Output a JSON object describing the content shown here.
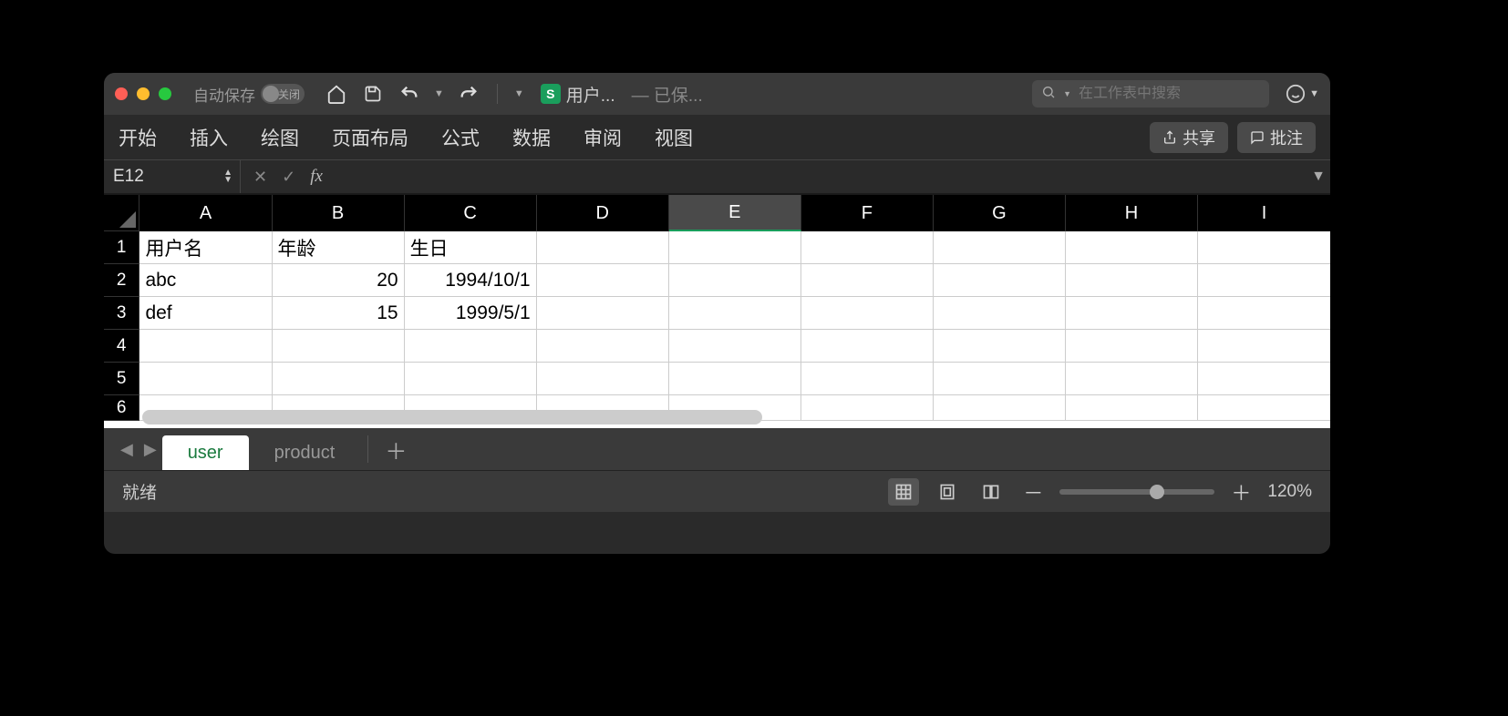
{
  "titlebar": {
    "autosave_label": "自动保存",
    "autosave_state": "关闭",
    "doc_title": "用户...",
    "saved_text": "— 已保...",
    "search_placeholder": "在工作表中搜索"
  },
  "ribbon": {
    "tabs": [
      "开始",
      "插入",
      "绘图",
      "页面布局",
      "公式",
      "数据",
      "审阅",
      "视图"
    ],
    "share": "共享",
    "comment": "批注"
  },
  "formula": {
    "namebox": "E12",
    "value": ""
  },
  "grid": {
    "columns": [
      "A",
      "B",
      "C",
      "D",
      "E",
      "F",
      "G",
      "H",
      "I"
    ],
    "active_column_index": 4,
    "row_numbers": [
      1,
      2,
      3,
      4,
      5,
      6
    ],
    "headers": [
      "用户名",
      "年龄",
      "生日"
    ],
    "rows": [
      {
        "name": "abc",
        "age": "20",
        "birth": "1994/10/1"
      },
      {
        "name": "def",
        "age": "15",
        "birth": "1999/5/1"
      }
    ]
  },
  "sheets": {
    "tabs": [
      {
        "name": "user",
        "active": true
      },
      {
        "name": "product",
        "active": false
      }
    ]
  },
  "status": {
    "ready": "就绪",
    "zoom": "120%"
  }
}
